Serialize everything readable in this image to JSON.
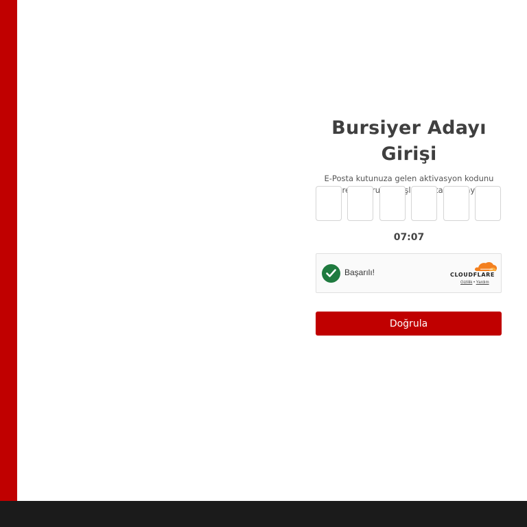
{
  "page": {
    "title": "Bursiyer Adayı Girişi",
    "description": "E-Posta kutunuza gelen aktivasyon kodunu girerek doğrulama işlemini tamamlayınız."
  },
  "code_inputs": [
    "",
    "",
    "",
    "",
    "",
    ""
  ],
  "timer": "07:07",
  "captcha": {
    "status": "Başarılı!",
    "provider": "CLOUDFLARE",
    "privacy_link": "Gizlilik",
    "separator": "•",
    "terms_link": "Yardım",
    "icon": "checkmark-circle-icon",
    "logo_icon": "cloudflare-cloud-icon"
  },
  "verify_button": "Doğrula",
  "colors": {
    "accent": "#c00000",
    "footer": "#1b1b1b",
    "success": "#1f7a3f",
    "cloudflare_orange": "#f38020"
  }
}
